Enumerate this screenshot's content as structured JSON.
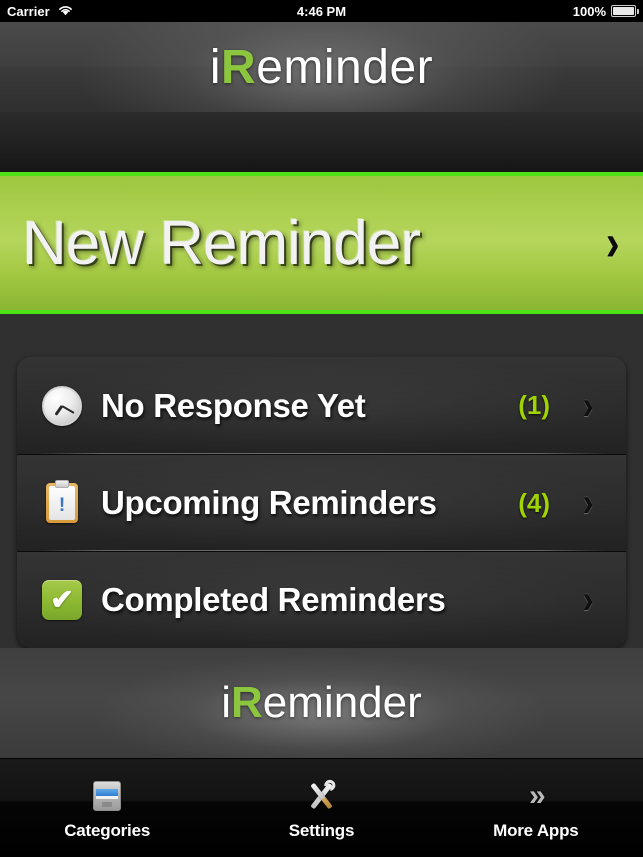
{
  "status_bar": {
    "carrier": "Carrier",
    "time": "4:46 PM",
    "battery_percent": "100%",
    "wifi_icon": "wifi-icon",
    "battery_icon": "battery-icon"
  },
  "header": {
    "logo_prefix": "i",
    "logo_accent": "R",
    "logo_suffix": "eminder"
  },
  "banner": {
    "label": "New Reminder",
    "chevron": "›",
    "accent_color": "#4ce216",
    "fill_color": "#a9ce4c"
  },
  "list": {
    "rows": [
      {
        "label": "No Response Yet",
        "count": "(1)",
        "icon": "clock-icon",
        "chevron": "›"
      },
      {
        "label": "Upcoming Reminders",
        "count": "(4)",
        "icon": "clipboard-icon",
        "icon_mark": "!",
        "chevron": "›"
      },
      {
        "label": "Completed Reminders",
        "count": "",
        "icon": "checkmark-icon",
        "icon_mark": "✔",
        "chevron": "›"
      }
    ],
    "count_color": "#9ed402"
  },
  "footer": {
    "logo_prefix": "i",
    "logo_accent": "R",
    "logo_suffix": "eminder"
  },
  "tab_bar": {
    "tabs": [
      {
        "label": "Categories",
        "icon": "file-cabinet-icon"
      },
      {
        "label": "Settings",
        "icon": "tools-icon"
      },
      {
        "label": "More Apps",
        "icon": "double-chevron-icon",
        "glyph": "»"
      }
    ]
  }
}
